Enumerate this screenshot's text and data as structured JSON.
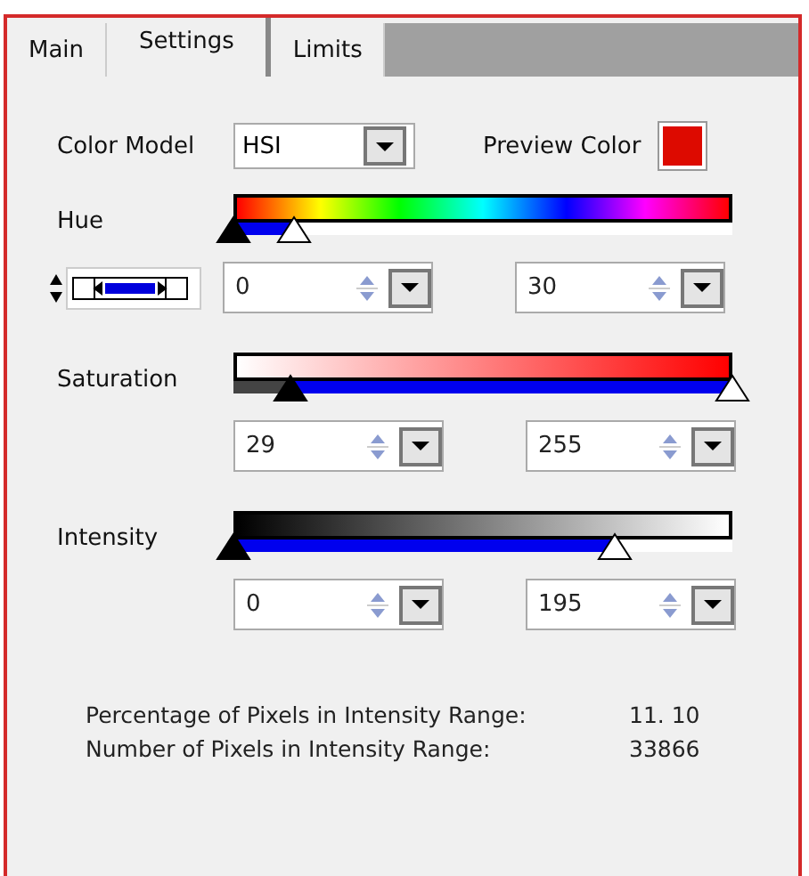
{
  "tabs": [
    {
      "label": "Main",
      "selected": false
    },
    {
      "label": "Settings",
      "selected": true
    },
    {
      "label": "Limits",
      "selected": false
    }
  ],
  "color_model": {
    "label": "Color Model",
    "value": "HSI"
  },
  "preview": {
    "label": "Preview Color",
    "color": "#dd0a00"
  },
  "channels": [
    {
      "kind": "hue",
      "label": "Hue",
      "low": {
        "level": 0,
        "value": "0"
      },
      "high": {
        "level": 0.12,
        "value": "30"
      }
    },
    {
      "kind": "saturation",
      "label": "Saturation",
      "low": {
        "level": 0.114,
        "value": "29"
      },
      "high": {
        "level": 1,
        "value": "255"
      }
    },
    {
      "kind": "intensity",
      "label": "Intensity",
      "low": {
        "level": 0,
        "value": "0"
      },
      "high": {
        "level": 0.765,
        "value": "195"
      }
    }
  ],
  "stats": [
    {
      "label": "Percentage of Pixels in Intensity Range:",
      "value": "11. 10"
    },
    {
      "label": "Number of Pixels in Intensity Range:",
      "value": "33866"
    }
  ]
}
